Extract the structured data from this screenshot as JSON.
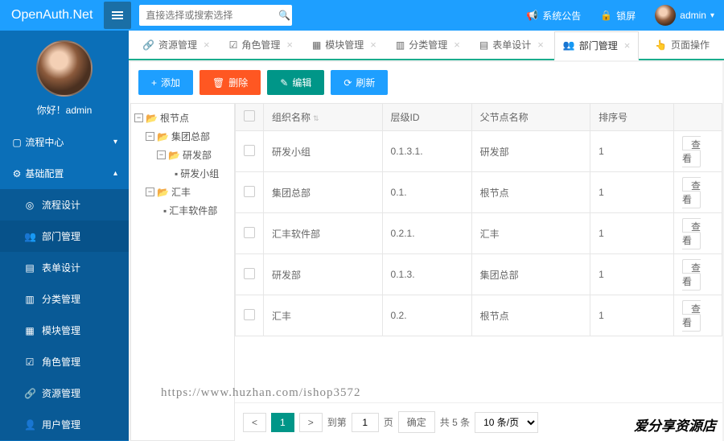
{
  "brand": "OpenAuth.Net",
  "search": {
    "placeholder": "直接选择或搜索选择"
  },
  "top": {
    "announce": "系统公告",
    "lock": "锁屏",
    "user": "admin"
  },
  "welcome": "你好！admin",
  "nav": {
    "flow_center": "流程中心",
    "base_config": "基础配置",
    "items": [
      "流程设计",
      "部门管理",
      "表单设计",
      "分类管理",
      "模块管理",
      "角色管理",
      "资源管理",
      "用户管理"
    ]
  },
  "tabs": {
    "list": [
      "资源管理",
      "角色管理",
      "模块管理",
      "分类管理",
      "表单设计",
      "部门管理"
    ],
    "active": "部门管理",
    "page_ops": "页面操作"
  },
  "toolbar": {
    "add": "添加",
    "del": "删除",
    "edit": "编辑",
    "refresh": "刷新"
  },
  "tree": {
    "root": "根节点",
    "n1": "集团总部",
    "n1a": "研发部",
    "n1a1": "研发小组",
    "n2": "汇丰",
    "n2a": "汇丰软件部"
  },
  "table": {
    "cols": {
      "org": "组织名称",
      "level": "层级ID",
      "parent": "父节点名称",
      "sort": "排序号"
    },
    "view": "查看",
    "rows": [
      {
        "org": "研发小组",
        "level": "0.1.3.1.",
        "parent": "研发部",
        "sort": "1"
      },
      {
        "org": "集团总部",
        "level": "0.1.",
        "parent": "根节点",
        "sort": "1"
      },
      {
        "org": "汇丰软件部",
        "level": "0.2.1.",
        "parent": "汇丰",
        "sort": "1"
      },
      {
        "org": "研发部",
        "level": "0.1.3.",
        "parent": "集团总部",
        "sort": "1"
      },
      {
        "org": "汇丰",
        "level": "0.2.",
        "parent": "根节点",
        "sort": "1"
      }
    ]
  },
  "pager": {
    "cur": "1",
    "to": "到第",
    "page_input": "1",
    "page": "页",
    "ok": "确定",
    "total": "共 5 条",
    "size": "10 条/页"
  },
  "watermark": "https://www.huzhan.com/ishop3572",
  "shopmark": "爱分享资源店"
}
